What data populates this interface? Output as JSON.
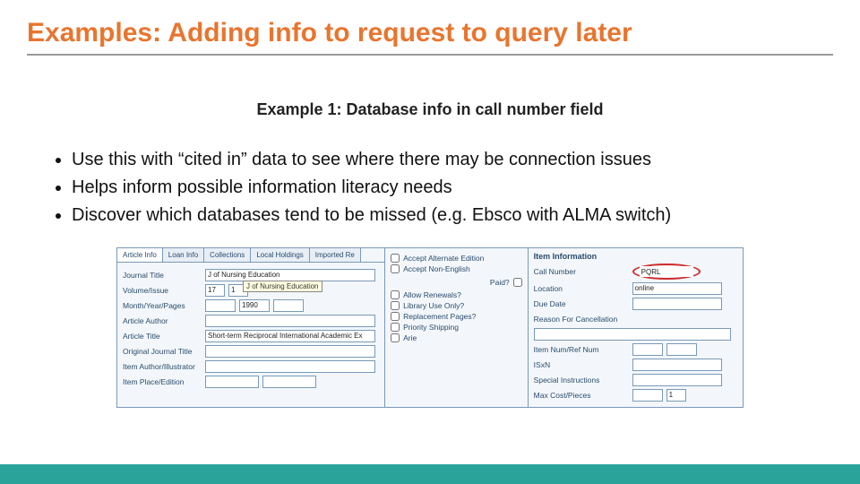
{
  "title": "Examples: Adding info to request to query later",
  "subtitle": "Example 1: Database info in call number field",
  "bullets": [
    "Use this with “cited in” data to see where there may be connection issues",
    "Helps inform possible information literacy needs",
    "Discover which databases tend to be missed (e.g. Ebsco with ALMA switch)"
  ],
  "screenshot": {
    "tabs": [
      "Article Info",
      "Loan Info",
      "Collections",
      "Local Holdings",
      "Imported Re"
    ],
    "active_tab": "Article Info",
    "tooltip": "J of Nursing Education",
    "col1": {
      "journal_title_label": "Journal Title",
      "journal_title_value": "J of Nursing Education",
      "volume_issue_label": "Volume/Issue",
      "volume_value": "17",
      "issue_value": "1",
      "month_year_pages_label": "Month/Year/Pages",
      "month_value": "",
      "year_value": "1990",
      "pages_value": "",
      "article_author_label": "Article Author",
      "article_author_value": "",
      "article_title_label": "Article Title",
      "article_title_value": "Short-term Reciprocal International Academic Ex",
      "original_journal_title_label": "Original Journal Title",
      "original_journal_title_value": "",
      "item_author_label": "Item Author/Illustrator",
      "item_author_value": "",
      "item_place_label": "Item Place/Edition",
      "item_place_value": ""
    },
    "col2": {
      "paid_label": "Paid?",
      "checks": [
        "Accept Alternate Edition",
        "Accept Non-English",
        "",
        "Allow Renewals?",
        "Library Use Only?",
        "Replacement Pages?",
        "Priority Shipping",
        "Arie"
      ]
    },
    "col3": {
      "header": "Item Information",
      "call_number_label": "Call Number",
      "call_number_value": "PQRL",
      "location_label": "Location",
      "location_value": "online",
      "due_date_label": "Due Date",
      "due_date_value": "",
      "reason_cancel_label": "Reason For Cancellation",
      "reason_cancel_value": "",
      "item_num_label": "Item Num/Ref Num",
      "item_num_value": "",
      "isxn_label": "ISxN",
      "isxn_value": "",
      "special_label": "Special Instructions",
      "special_value": "",
      "max_cost_label": "Max Cost/Pieces",
      "max_cost_value": "",
      "pieces_value": "1"
    }
  }
}
